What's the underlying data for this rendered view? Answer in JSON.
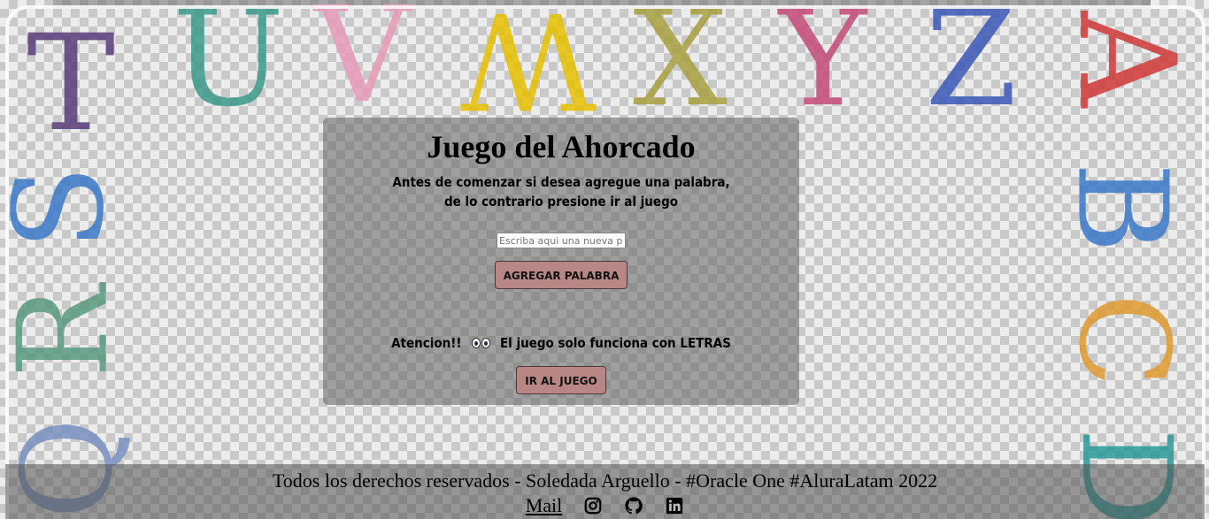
{
  "background_letters": [
    "T",
    "U",
    "V",
    "W",
    "X",
    "Y",
    "Z",
    "A",
    "S",
    "R",
    "Q",
    "B",
    "C",
    "D"
  ],
  "panel": {
    "title": "Juego del Ahorcado",
    "intro_line1": "Antes de comenzar si desea agregue una palabra,",
    "intro_line2": "de lo contrario presione ir al juego",
    "input_value": "",
    "input_placeholder": "Escriba aqui una nueva palabra",
    "add_button": "AGREGAR PALABRA",
    "warning_before": "Atencion!!",
    "warning_after": "El juego solo funciona con LETRAS",
    "play_button": "IR AL JUEGO"
  },
  "footer": {
    "copyright": "Todos los derechos reservados - Soledada Arguello - #Oracle One #AluraLatam 2022",
    "mail_link": "Mail",
    "icons": [
      "instagram-icon",
      "github-icon",
      "linkedin-icon"
    ]
  },
  "colors": {
    "button_bg": "#b98686",
    "panel_bg": "rgba(96,96,96,0.55)"
  }
}
